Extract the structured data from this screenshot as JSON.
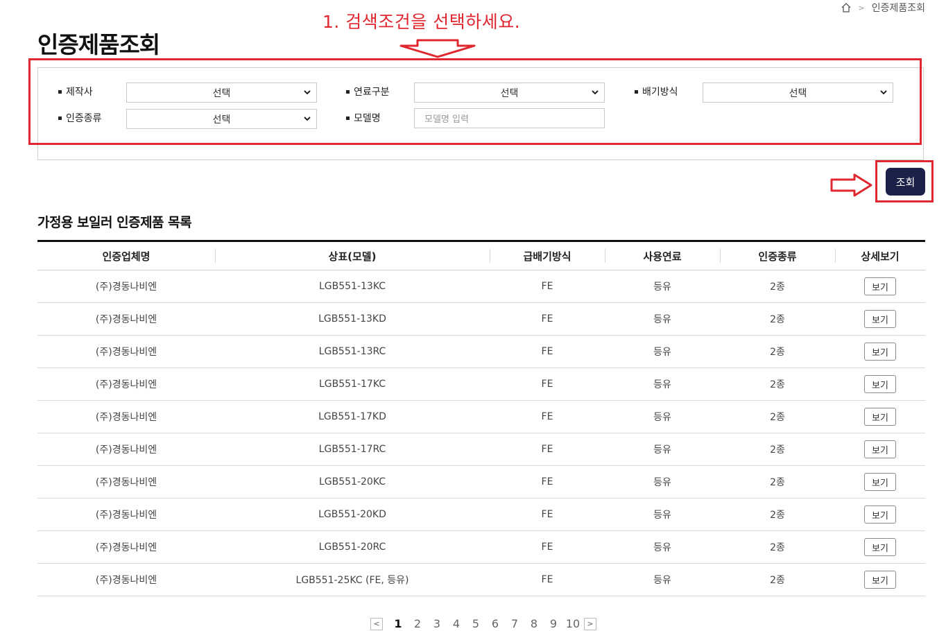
{
  "breadcrumb": {
    "current": "인증제품조회"
  },
  "annotation": {
    "text": "1. 검색조건을 선택하세요.",
    "color": "#e0262e"
  },
  "page": {
    "title": "인증제품조회"
  },
  "search": {
    "maker": {
      "label": "제작사",
      "value": "선택"
    },
    "fuel": {
      "label": "연료구분",
      "value": "선택"
    },
    "exhaust": {
      "label": "배기방식",
      "value": "선택"
    },
    "cert_type": {
      "label": "인증종류",
      "value": "선택"
    },
    "model": {
      "label": "모델명",
      "placeholder": "모델명 입력"
    },
    "button_label": "조회",
    "button_color": "#1b2149"
  },
  "list": {
    "title": "가정용 보일러 인증제품 목록",
    "columns": [
      "인증업체명",
      "상표(모델)",
      "급배기방식",
      "사용연료",
      "인증종류",
      "상세보기"
    ],
    "view_label": "보기",
    "rows": [
      {
        "company": "(주)경동나비엔",
        "model": "LGB551-13KC",
        "exhaust": "FE",
        "fuel": "등유",
        "cert": "2종"
      },
      {
        "company": "(주)경동나비엔",
        "model": "LGB551-13KD",
        "exhaust": "FE",
        "fuel": "등유",
        "cert": "2종"
      },
      {
        "company": "(주)경동나비엔",
        "model": "LGB551-13RC",
        "exhaust": "FE",
        "fuel": "등유",
        "cert": "2종"
      },
      {
        "company": "(주)경동나비엔",
        "model": "LGB551-17KC",
        "exhaust": "FE",
        "fuel": "등유",
        "cert": "2종"
      },
      {
        "company": "(주)경동나비엔",
        "model": "LGB551-17KD",
        "exhaust": "FE",
        "fuel": "등유",
        "cert": "2종"
      },
      {
        "company": "(주)경동나비엔",
        "model": "LGB551-17RC",
        "exhaust": "FE",
        "fuel": "등유",
        "cert": "2종"
      },
      {
        "company": "(주)경동나비엔",
        "model": "LGB551-20KC",
        "exhaust": "FE",
        "fuel": "등유",
        "cert": "2종"
      },
      {
        "company": "(주)경동나비엔",
        "model": "LGB551-20KD",
        "exhaust": "FE",
        "fuel": "등유",
        "cert": "2종"
      },
      {
        "company": "(주)경동나비엔",
        "model": "LGB551-20RC",
        "exhaust": "FE",
        "fuel": "등유",
        "cert": "2종"
      },
      {
        "company": "(주)경동나비엔",
        "model": "LGB551-25KC (FE, 등유)",
        "exhaust": "FE",
        "fuel": "등유",
        "cert": "2종"
      }
    ]
  },
  "pagination": {
    "prev": "<",
    "next": ">",
    "pages": [
      "1",
      "2",
      "3",
      "4",
      "5",
      "6",
      "7",
      "8",
      "9",
      "10"
    ],
    "current": "1"
  }
}
